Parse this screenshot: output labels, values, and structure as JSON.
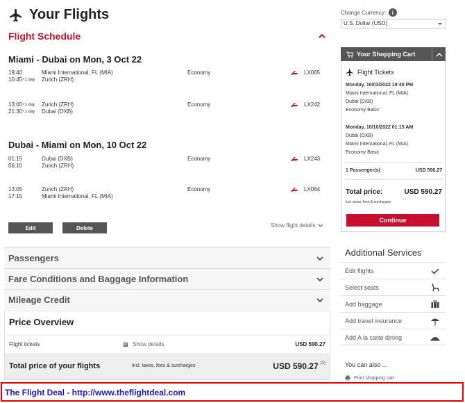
{
  "page": {
    "title": "Your Flights"
  },
  "schedule": {
    "title": "Flight Schedule",
    "routes": [
      {
        "title": "Miami - Dubai on Mon, 3 Oct 22",
        "segments": [
          {
            "dep_time": "19:40",
            "dep_offset": "",
            "dep_place": "Miami International, FL (MIA)",
            "arr_time": "10:45",
            "arr_offset": "+1 day",
            "arr_place": "Zurich (ZRH)",
            "cabin": "Economy",
            "flight": "LX065"
          },
          {
            "dep_time": "13:00",
            "dep_offset": "+1 day",
            "dep_place": "Zurich (ZRH)",
            "arr_time": "21:30",
            "arr_offset": "+1 day",
            "arr_place": "Dubai (DXB)",
            "cabin": "Economy",
            "flight": "LX242"
          }
        ]
      },
      {
        "title": "Dubai - Miami on Mon, 10 Oct 22",
        "segments": [
          {
            "dep_time": "01:15",
            "dep_offset": "",
            "dep_place": "Dubai (DXB)",
            "arr_time": "06:10",
            "arr_offset": "",
            "arr_place": "Zurich (ZRH)",
            "cabin": "Economy",
            "flight": "LX243"
          },
          {
            "dep_time": "13:05",
            "dep_offset": "",
            "dep_place": "Zurich (ZRH)",
            "arr_time": "17:15",
            "arr_offset": "",
            "arr_place": "Miami International, FL (MIA)",
            "cabin": "Economy",
            "flight": "LX064"
          }
        ]
      }
    ],
    "edit_label": "Edit",
    "delete_label": "Delete",
    "show_details_label": "Show flight details"
  },
  "sections": {
    "passengers": "Passengers",
    "fare": "Fare Conditions and Baggage Information",
    "mileage": "Mileage Credit"
  },
  "price": {
    "title": "Price Overview",
    "flight_tickets_label": "Flight tickets",
    "show_details_label": "Show details",
    "flight_tickets_value": "USD 590.27",
    "total_label": "Total price of your flights",
    "total_note": "incl. taxes, fees & surcharges",
    "total_value": "USD 590.27",
    "total_footnote": "(1)"
  },
  "currency": {
    "label": "Change Currency:",
    "selected": "U.S. Dollar (USD)"
  },
  "cart": {
    "title": "Your Shopping Cart",
    "flight_tickets": "Flight Tickets",
    "outbound": {
      "datetime": "Monday, 10/03/2022 19:40 PM",
      "from": "Miami International, FL (MIA)",
      "to": "Dubai (DXB)",
      "fare": "Economy Basic"
    },
    "inbound": {
      "datetime": "Monday, 10/10/2022 01:15 AM",
      "from": "Dubai (DXB)",
      "to": "Miami International, FL (MIA)",
      "fare": "Economy Basic"
    },
    "passengers_label": "1 Passenger(s)",
    "passengers_value": "USD 590.27",
    "total_label": "Total price:",
    "total_value": "USD 590.27",
    "total_note": "incl. taxes, fees & surcharges",
    "continue_label": "Continue"
  },
  "additional": {
    "title": "Additional Services",
    "items": [
      "Edit flights",
      "Select seats",
      "Add baggage",
      "Add travel insurance",
      "Add A la carte dining"
    ],
    "you_can_also": "You can also ...",
    "print_label": "Print shopping cart"
  },
  "banner": {
    "text": "The Flight Deal - http://www.theflightdeal.com"
  },
  "colors": {
    "accent": "#c8102e",
    "dark": "#555555",
    "banner_text": "#1a1acc",
    "banner_border": "#ee0000"
  }
}
